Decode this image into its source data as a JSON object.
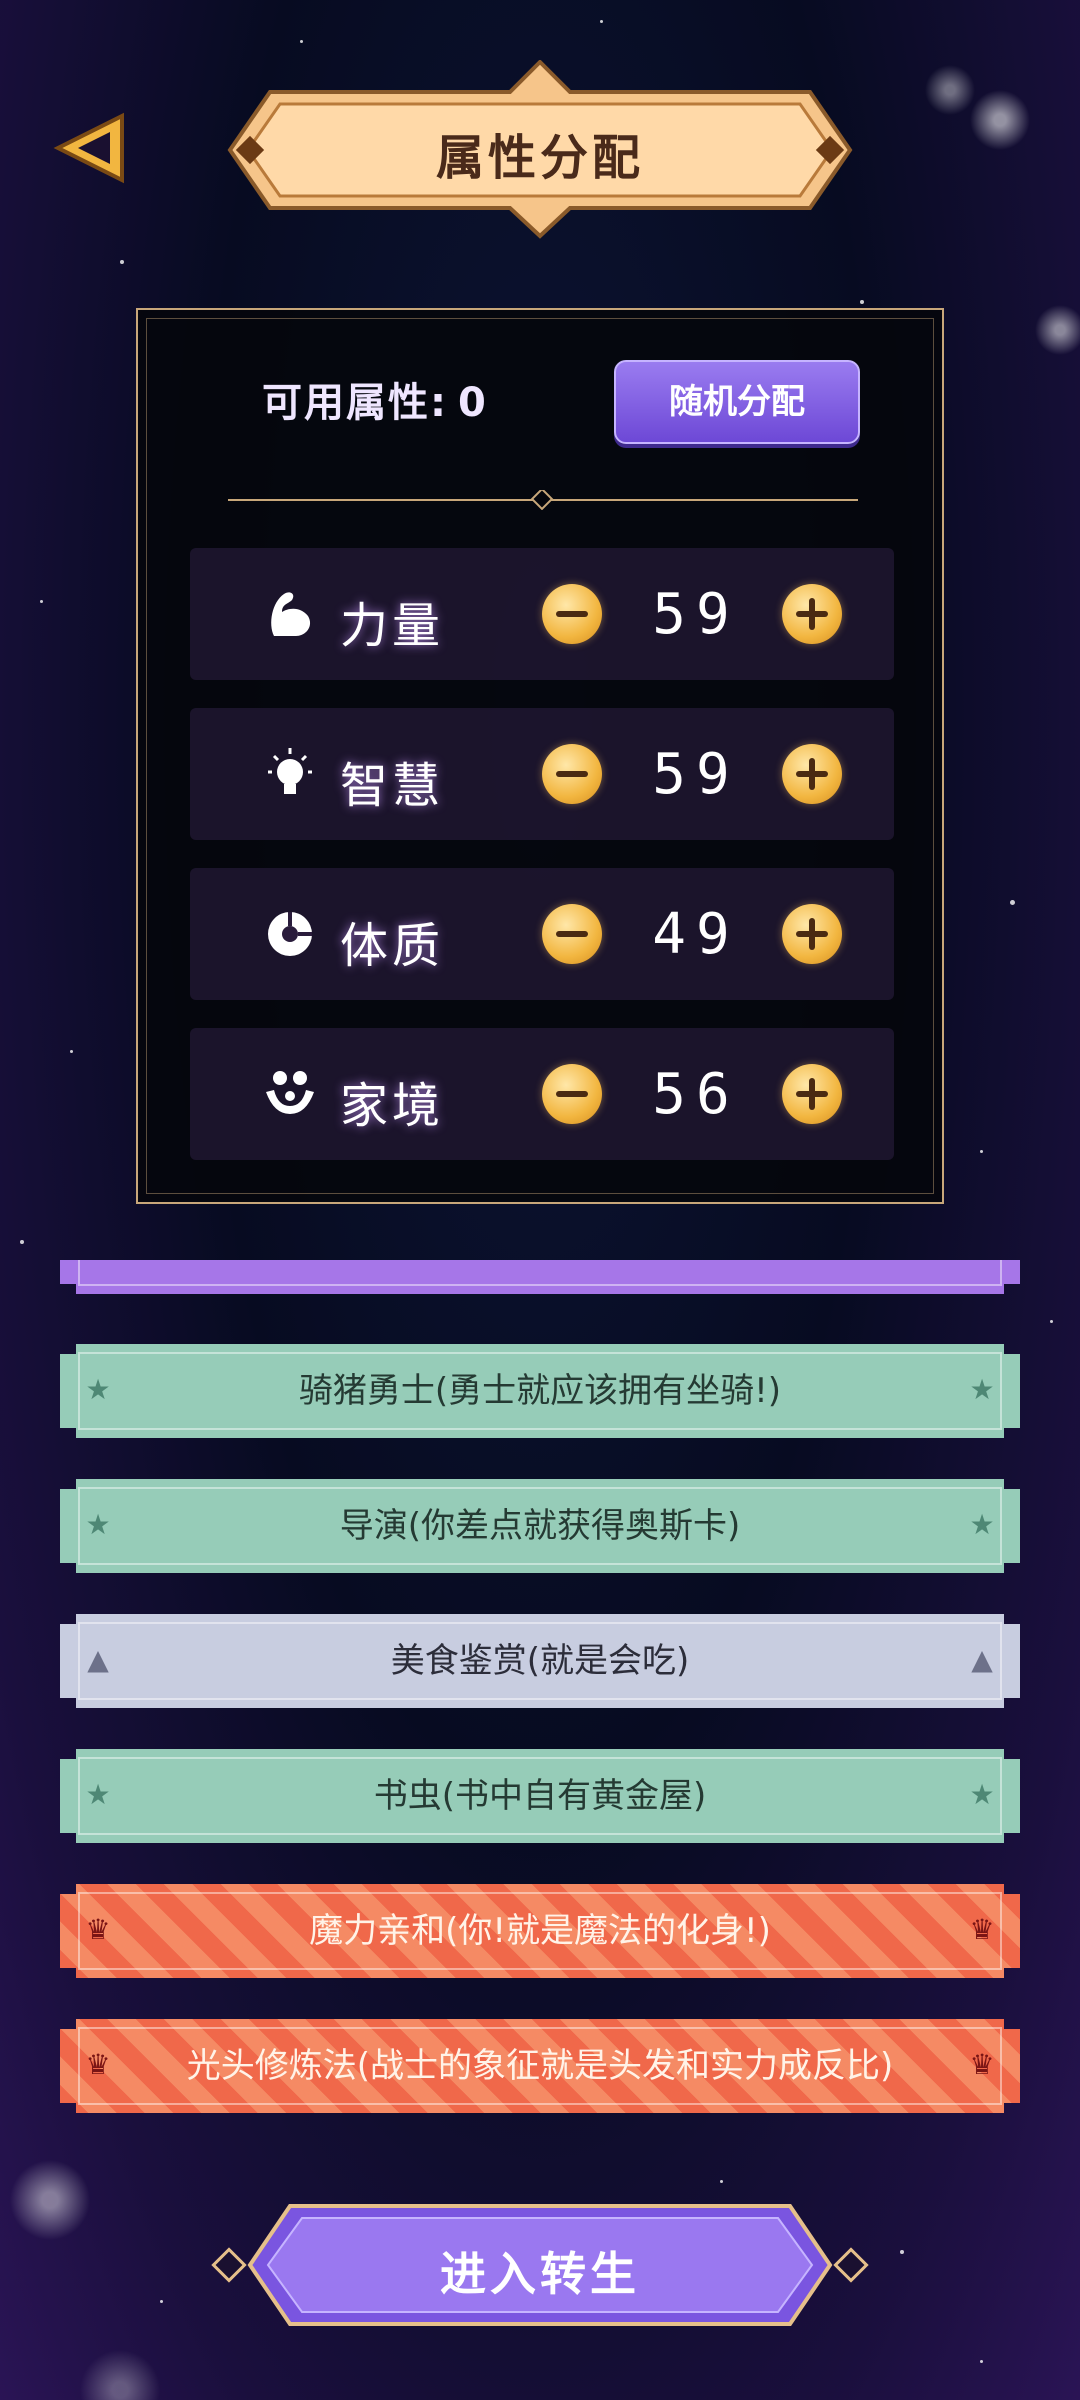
{
  "header": {
    "title": "属性分配"
  },
  "panel": {
    "available_label": "可用属性:",
    "available_value": "0",
    "random_button": "随机分配"
  },
  "attributes": [
    {
      "name": "力量",
      "value": "59",
      "icon": "muscle-icon"
    },
    {
      "name": "智慧",
      "value": "59",
      "icon": "lightbulb-icon"
    },
    {
      "name": "体质",
      "value": "49",
      "icon": "constitution-icon"
    },
    {
      "name": "家境",
      "value": "56",
      "icon": "family-icon"
    }
  ],
  "talents": [
    {
      "label": "骑猪勇士(勇士就应该拥有坐骑!)",
      "rarity": "green"
    },
    {
      "label": "导演(你差点就获得奥斯卡)",
      "rarity": "green"
    },
    {
      "label": "美食鉴赏(就是会吃)",
      "rarity": "gray"
    },
    {
      "label": "书虫(书中自有黄金屋)",
      "rarity": "green"
    },
    {
      "label": "魔力亲和(你!就是魔法的化身!)",
      "rarity": "red"
    },
    {
      "label": "光头修炼法(战士的象征就是头发和实力成反比)",
      "rarity": "red"
    }
  ],
  "footer": {
    "enter_button": "进入转生"
  },
  "colors": {
    "gold": "#f2b640",
    "purple": "#7a55e0",
    "green_talent": "#96ccb8",
    "gray_talent": "#c8cde0",
    "red_talent": "#f0684a"
  }
}
